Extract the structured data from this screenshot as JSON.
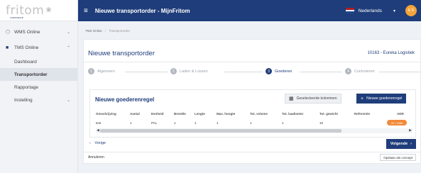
{
  "brand": {
    "logo_text": "fritom",
    "logo_sub": "CORPORATE"
  },
  "topbar": {
    "title": "Nieuwe transportorder - MijnFritom",
    "language": "Nederlands",
    "avatar_initials": "E R"
  },
  "sidebar": {
    "items": [
      {
        "label": "WMS Online",
        "icon": "box-icon"
      },
      {
        "label": "TMS Online",
        "icon": "truck-icon"
      }
    ],
    "sub_items": [
      "Dashboard",
      "Transportorder",
      "Rapportage",
      "Instelling"
    ],
    "selected": "Transportorder"
  },
  "breadcrumb": {
    "root": "TMS Online",
    "separator": "/",
    "current": "Transportorder"
  },
  "page": {
    "title": "Nieuwe transportorder",
    "company": "10163 - Eureka Logistiek"
  },
  "steps": [
    {
      "num": "1",
      "label": "Algemeen",
      "active": false
    },
    {
      "num": "2",
      "label": "Laden & Lossen",
      "active": false
    },
    {
      "num": "3",
      "label": "Goederen",
      "active": true
    },
    {
      "num": "4",
      "label": "Controleren",
      "active": false
    }
  ],
  "goods": {
    "title": "Nieuwe goederenregel",
    "columns_button": "Geselecteerde kolommen",
    "new_button": "Nieuwe goederenregel",
    "headers": [
      "Omschrijving",
      "Aantal",
      "Eenheid",
      "Breedte",
      "Lengte",
      "Max. hoogte",
      "Tot. volume",
      "Tot. laadmeter",
      "Tot. gewicht",
      "Referentie",
      "ADR"
    ],
    "row": [
      "test",
      "1",
      "PAL",
      "1",
      "1",
      "1",
      "1",
      "1",
      "10",
      "",
      ""
    ],
    "adr_badge": "33 / 1066"
  },
  "nav": {
    "prev": "Vorige",
    "next": "Volgende"
  },
  "footer": {
    "cancel": "Annuleren",
    "save_draft": "Opslaan als concept"
  },
  "colors": {
    "primary": "#1f3d7a",
    "accent": "#f2893a",
    "avatar": "#f2a33a"
  }
}
